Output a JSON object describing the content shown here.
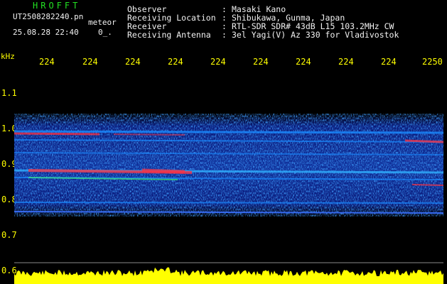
{
  "header": {
    "logo": "HROFFT",
    "filename": "UT2508282240.pn",
    "type_label": "meteor",
    "datetime": "25.08.28 22:40",
    "marker": "0_."
  },
  "info": {
    "observer_label": "Observer",
    "observer": "Masaki Kano",
    "location_label": "Receiving Location",
    "location": "Shibukawa, Gunma, Japan",
    "receiver_label": "Receiver",
    "receiver": "RTL-SDR SDR# 43dB L15 103.2MHz CW",
    "antenna_label": "Receiving Antenna",
    "antenna": "3el Yagi(V) Az 330 for Vladivostok",
    "separator": ":"
  },
  "axes": {
    "y_unit": "kHz",
    "x_ticks": [
      "224",
      "224",
      "224",
      "224",
      "224",
      "224",
      "224",
      "224",
      "224",
      "2250"
    ],
    "y_ticks": [
      "1.1",
      "1.0",
      "0.9",
      "0.8",
      "0.7",
      "0.6"
    ]
  },
  "colors": {
    "background": "#000000",
    "axis_text": "#ffff00",
    "header_text": "#ffffff",
    "logo": "#22e022",
    "spectrum_low": "#0a1a7a",
    "spectrum_mid": "#1a8aff",
    "spectrum_high": "#ff3040",
    "trace": "#ffff00"
  }
}
